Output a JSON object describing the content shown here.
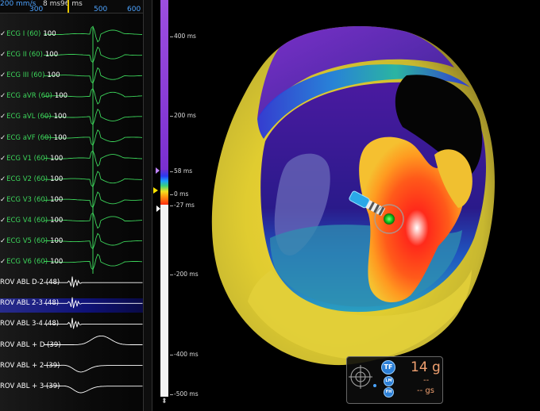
{
  "time_ruler": {
    "speed": "200 mm/s",
    "ms_value": "8 ms",
    "window": "96 ms",
    "tick_300": "300",
    "tick_500": "500",
    "tick_600": "600"
  },
  "leads": [
    {
      "label": "ECG I (60)",
      "gain": "100",
      "type": "ecg",
      "checked": true
    },
    {
      "label": "ECG II (60)",
      "gain": "100",
      "type": "ecg",
      "checked": true
    },
    {
      "label": "ECG III (60)",
      "gain": "100",
      "type": "ecg",
      "checked": true
    },
    {
      "label": "ECG aVR (60)",
      "gain": "100",
      "type": "ecg",
      "checked": true
    },
    {
      "label": "ECG aVL (60)",
      "gain": "100",
      "type": "ecg",
      "checked": true
    },
    {
      "label": "ECG aVF (60)",
      "gain": "100",
      "type": "ecg",
      "checked": true
    },
    {
      "label": "ECG V1 (60)",
      "gain": "100",
      "type": "ecg",
      "checked": true
    },
    {
      "label": "ECG V2 (60)",
      "gain": "100",
      "type": "ecg",
      "checked": true
    },
    {
      "label": "ECG V3 (60)",
      "gain": "100",
      "type": "ecg",
      "checked": true
    },
    {
      "label": "ECG V4 (60)",
      "gain": "100",
      "type": "ecg",
      "checked": true
    },
    {
      "label": "ECG V5 (60)",
      "gain": "100",
      "type": "ecg",
      "checked": true
    },
    {
      "label": "ECG V6 (60)",
      "gain": "100",
      "type": "ecg",
      "checked": true
    },
    {
      "label": "ROV ABL   D-2 (48)",
      "gain": "",
      "type": "abl",
      "checked": false
    },
    {
      "label": "ROV ABL   2-3 (48)",
      "gain": "",
      "type": "abl",
      "checked": false
    },
    {
      "label": "ROV ABL   3-4 (48)",
      "gain": "",
      "type": "abl",
      "checked": false
    },
    {
      "label": "ROV ABL + D (39)",
      "gain": "",
      "type": "abl",
      "checked": false
    },
    {
      "label": "ROV ABL + 2 (39)",
      "gain": "",
      "type": "abl",
      "checked": false
    },
    {
      "label": "ROV ABL + 3 (39)",
      "gain": "",
      "type": "abl",
      "checked": false
    }
  ],
  "scale": {
    "labels": [
      "400 ms",
      "200 ms",
      "58 ms",
      "0 ms",
      "-27 ms",
      "-200 ms",
      "-400 ms",
      "-500 ms"
    ],
    "colors": {
      "early": "#ff2a10",
      "late": "#7a2fd0",
      "scar": "#f4f4f4"
    }
  },
  "contact_force": {
    "force": "14 g",
    "line2": "--",
    "line3": "-- gs",
    "btn_tf": "TF",
    "btn_lm": "LM",
    "btn_fh": "FH"
  },
  "icons": {
    "checkbox": "check-icon",
    "crosshair": "crosshair-icon",
    "scale_end": "chevron-updown-icon"
  }
}
